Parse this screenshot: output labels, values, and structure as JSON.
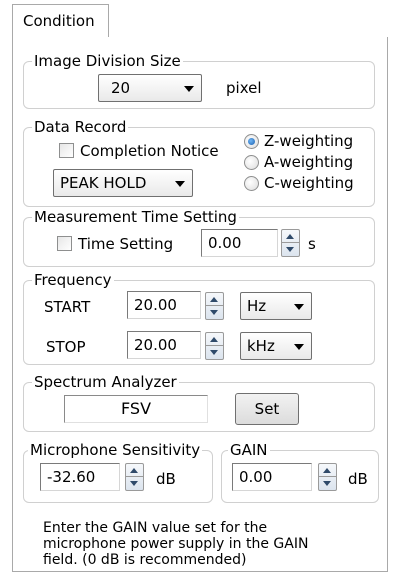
{
  "tabs": {
    "condition": "Condition"
  },
  "image_division": {
    "title": "Image Division Size",
    "value": "20",
    "unit": "pixel"
  },
  "data_record": {
    "title": "Data Record",
    "completion_notice": "Completion Notice",
    "completion_notice_checked": false,
    "mode": "PEAK HOLD",
    "weighting_options": [
      "Z-weighting",
      "A-weighting",
      "C-weighting"
    ],
    "weighting_selected": "Z-weighting"
  },
  "measurement_time": {
    "title": "Measurement Time Setting",
    "checkbox_label": "Time Setting",
    "checked": false,
    "value": "0.00",
    "unit": "s"
  },
  "frequency": {
    "title": "Frequency",
    "start_label": "START",
    "start_value": "20.00",
    "start_unit": "Hz",
    "stop_label": "STOP",
    "stop_value": "20.00",
    "stop_unit": "kHz"
  },
  "spectrum_analyzer": {
    "title": "Spectrum Analyzer",
    "device": "FSV",
    "set_label": "Set"
  },
  "microphone": {
    "title": "Microphone Sensitivity",
    "value": "-32.60",
    "unit": "dB"
  },
  "gain": {
    "title": "GAIN",
    "value": "0.00",
    "unit": "dB"
  },
  "note": [
    "Enter the GAIN value set for the",
    "microphone power supply in the GAIN",
    "field. (0 dB is recommended)"
  ]
}
